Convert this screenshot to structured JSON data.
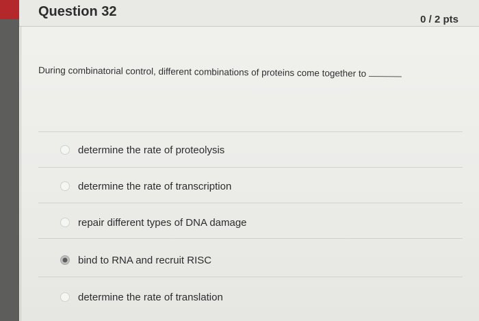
{
  "question": {
    "title": "Question 32",
    "points": "0 / 2 pts",
    "text": "During combinatorial control, different combinations of proteins come together to"
  },
  "answers": [
    {
      "label": "determine the rate of proteolysis",
      "selected": false
    },
    {
      "label": "determine the rate of transcription",
      "selected": false
    },
    {
      "label": "repair different types of DNA damage",
      "selected": false
    },
    {
      "label": "bind to RNA and recruit RISC",
      "selected": true
    },
    {
      "label": "determine the rate of translation",
      "selected": false
    }
  ],
  "colors": {
    "accent_corner": "#b4272a",
    "selected_radio": "#5a5d5c"
  }
}
